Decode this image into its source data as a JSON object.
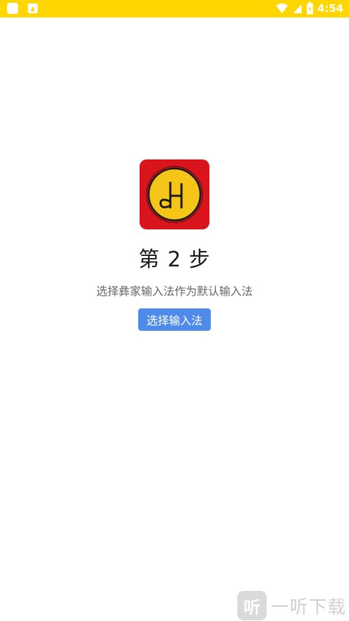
{
  "status_bar": {
    "time": "4:54",
    "background": "#FFD600",
    "icons": [
      "notification-icon",
      "app-notification-icon",
      "wifi-icon",
      "signal-icon",
      "battery-icon"
    ]
  },
  "logo": {
    "icon": "app-logo",
    "background": "#D9141C",
    "circle_color": "#F5C518"
  },
  "step": {
    "title": "第 2 步",
    "description": "选择彝家输入法作为默认输入法"
  },
  "action": {
    "button_label": "选择输入法",
    "button_color": "#4E8BEA"
  },
  "watermark": {
    "icon_text": "听",
    "text": "一听下载"
  }
}
